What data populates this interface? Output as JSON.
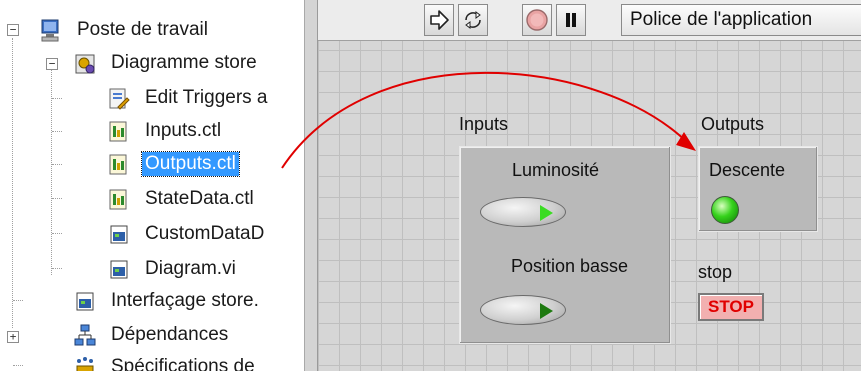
{
  "tree": {
    "items": [
      {
        "label": "Poste de travail"
      },
      {
        "label": "Diagramme store"
      },
      {
        "label": "Edit Triggers a"
      },
      {
        "label": "Inputs.ctl"
      },
      {
        "label": "Outputs.ctl"
      },
      {
        "label": "StateData.ctl"
      },
      {
        "label": "CustomDataD"
      },
      {
        "label": "Diagram.vi"
      },
      {
        "label": "Interfaçage store."
      },
      {
        "label": "Dépendances"
      },
      {
        "label": "Spécifications de"
      }
    ],
    "expanded_symbol": "−",
    "collapsed_symbol": "+"
  },
  "toolbar": {
    "font_label": "Police de l'application"
  },
  "front_panel": {
    "inputs_label": "Inputs",
    "outputs_label": "Outputs",
    "luminosite_label": "Luminosité",
    "position_label": "Position basse",
    "descente_label": "Descente",
    "stop_label": "stop",
    "stop_button_text": "STOP"
  },
  "colors": {
    "selection": "#3399ff",
    "arrow": "#e00000",
    "led_on": "#36d21c",
    "stop_text": "#e00000"
  }
}
